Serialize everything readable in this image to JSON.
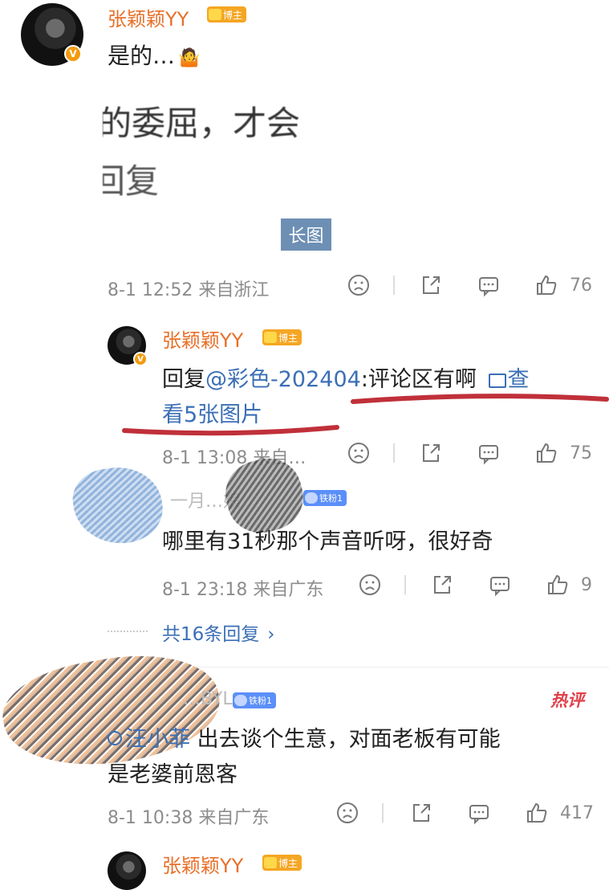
{
  "post": {
    "username": "张颖颖YY",
    "badge": "博主",
    "text": "是的…",
    "emoji": "🤷",
    "embedded_line1": "的委屈，才会",
    "embedded_line2": "回复",
    "long_image_tag": "长图",
    "meta": "8-1 12:52 来自浙江",
    "likes": "76"
  },
  "reply1": {
    "username": "张颖颖YY",
    "badge": "博主",
    "prefix": "回复",
    "mention": "@彩色-202404",
    "text": ":评论区有啊",
    "view_images_a": "查",
    "view_images_b": "看5张图片",
    "meta": "8-1 13:08 来自…",
    "likes": "75"
  },
  "reply2": {
    "username": "一月…娘",
    "badge": "铁粉1",
    "text": "哪里有31秒那个声音听呀，很好奇",
    "meta": "8-1 23:18 来自广东",
    "likes": "9"
  },
  "more_replies": "共16条回复",
  "comment": {
    "username": "…BYL",
    "badge": "铁粉1",
    "hot_tag": "热评",
    "search_word": "汪小菲",
    "text_line1": " 出去谈个生意，对面老板有可能",
    "text_line2": "是老婆前恩客",
    "meta": "8-1 10:38 来自广东",
    "likes": "417"
  },
  "next": {
    "username": "张颖颖YY",
    "badge": "博主"
  },
  "colors": {
    "username": "#e8702a",
    "link": "#3b6fb6",
    "meta": "#8c8c8c",
    "underline": "#c0303a",
    "hot": "#e0414b"
  }
}
